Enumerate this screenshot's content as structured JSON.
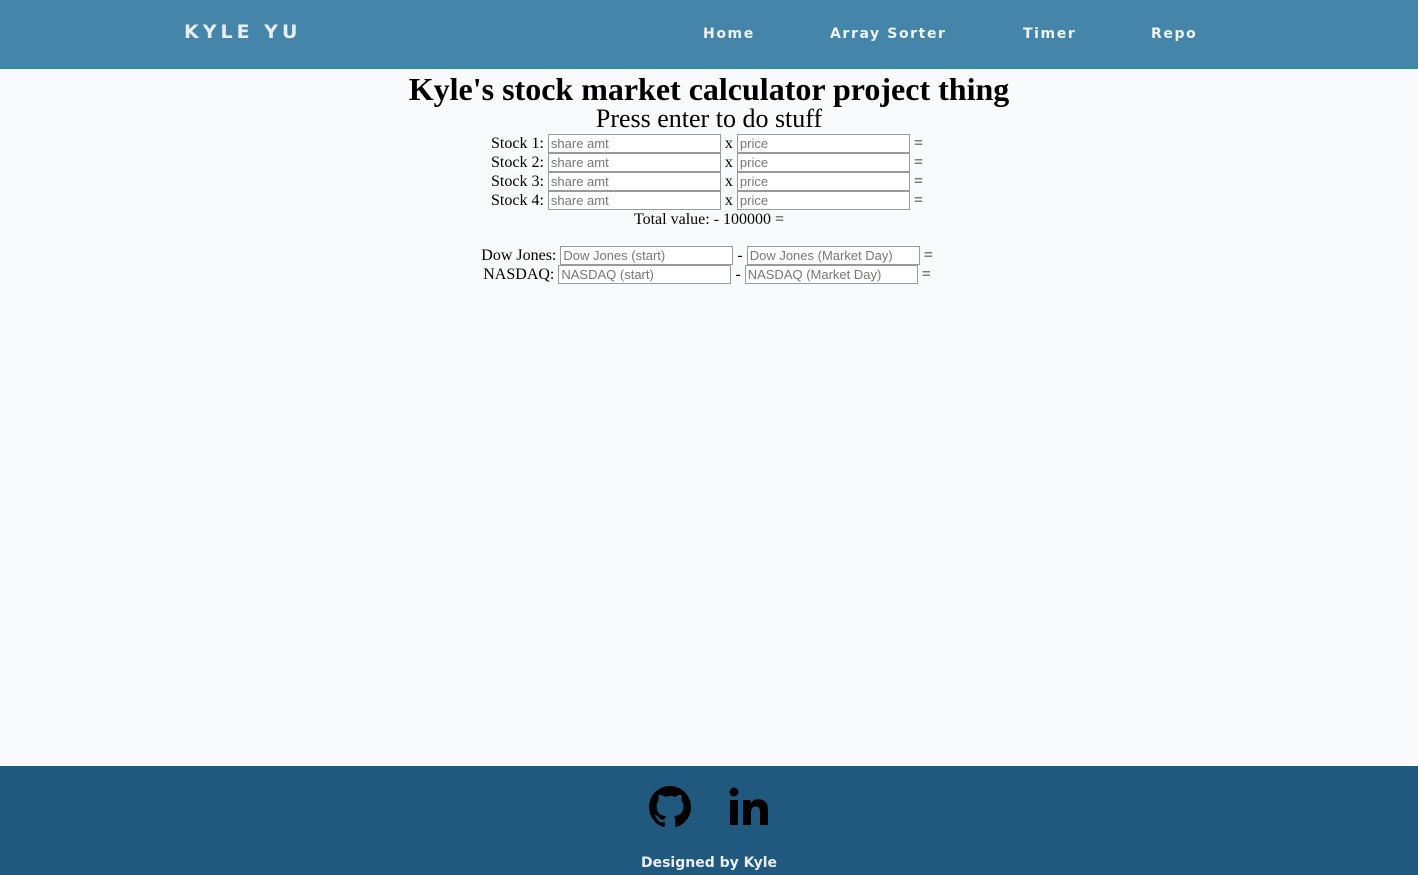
{
  "navbar": {
    "brand": "KYLE YU",
    "links": [
      "Home",
      "Array Sorter",
      "Timer",
      "Repo"
    ]
  },
  "main": {
    "title": "Kyle's stock market calculator project thing",
    "subtitle": "Press enter to do stuff",
    "stocks": [
      {
        "label": "Stock 1:",
        "shares_placeholder": "share amt",
        "price_placeholder": "price",
        "times": "x",
        "equals": "="
      },
      {
        "label": "Stock 2:",
        "shares_placeholder": "share amt",
        "price_placeholder": "price",
        "times": "x",
        "equals": "="
      },
      {
        "label": "Stock 3:",
        "shares_placeholder": "share amt",
        "price_placeholder": "price",
        "times": "x",
        "equals": "="
      },
      {
        "label": "Stock 4:",
        "shares_placeholder": "share amt",
        "price_placeholder": "price",
        "times": "x",
        "equals": "="
      }
    ],
    "total": "Total value: - 100000 =",
    "indexes": [
      {
        "label": "Dow Jones:",
        "start_placeholder": "Dow Jones (start)",
        "day_placeholder": "Dow Jones (Market Day)",
        "minus": "-",
        "equals": "="
      },
      {
        "label": "NASDAQ:",
        "start_placeholder": "NASDAQ (start)",
        "day_placeholder": "NASDAQ (Market Day)",
        "minus": "-",
        "equals": "="
      }
    ]
  },
  "footer": {
    "icons": [
      "github-icon",
      "linkedin-icon"
    ],
    "credit": "Designed by Kyle"
  },
  "colors": {
    "navbar": "#4585aa",
    "footer": "#20587e",
    "background": "#f8fafc"
  }
}
